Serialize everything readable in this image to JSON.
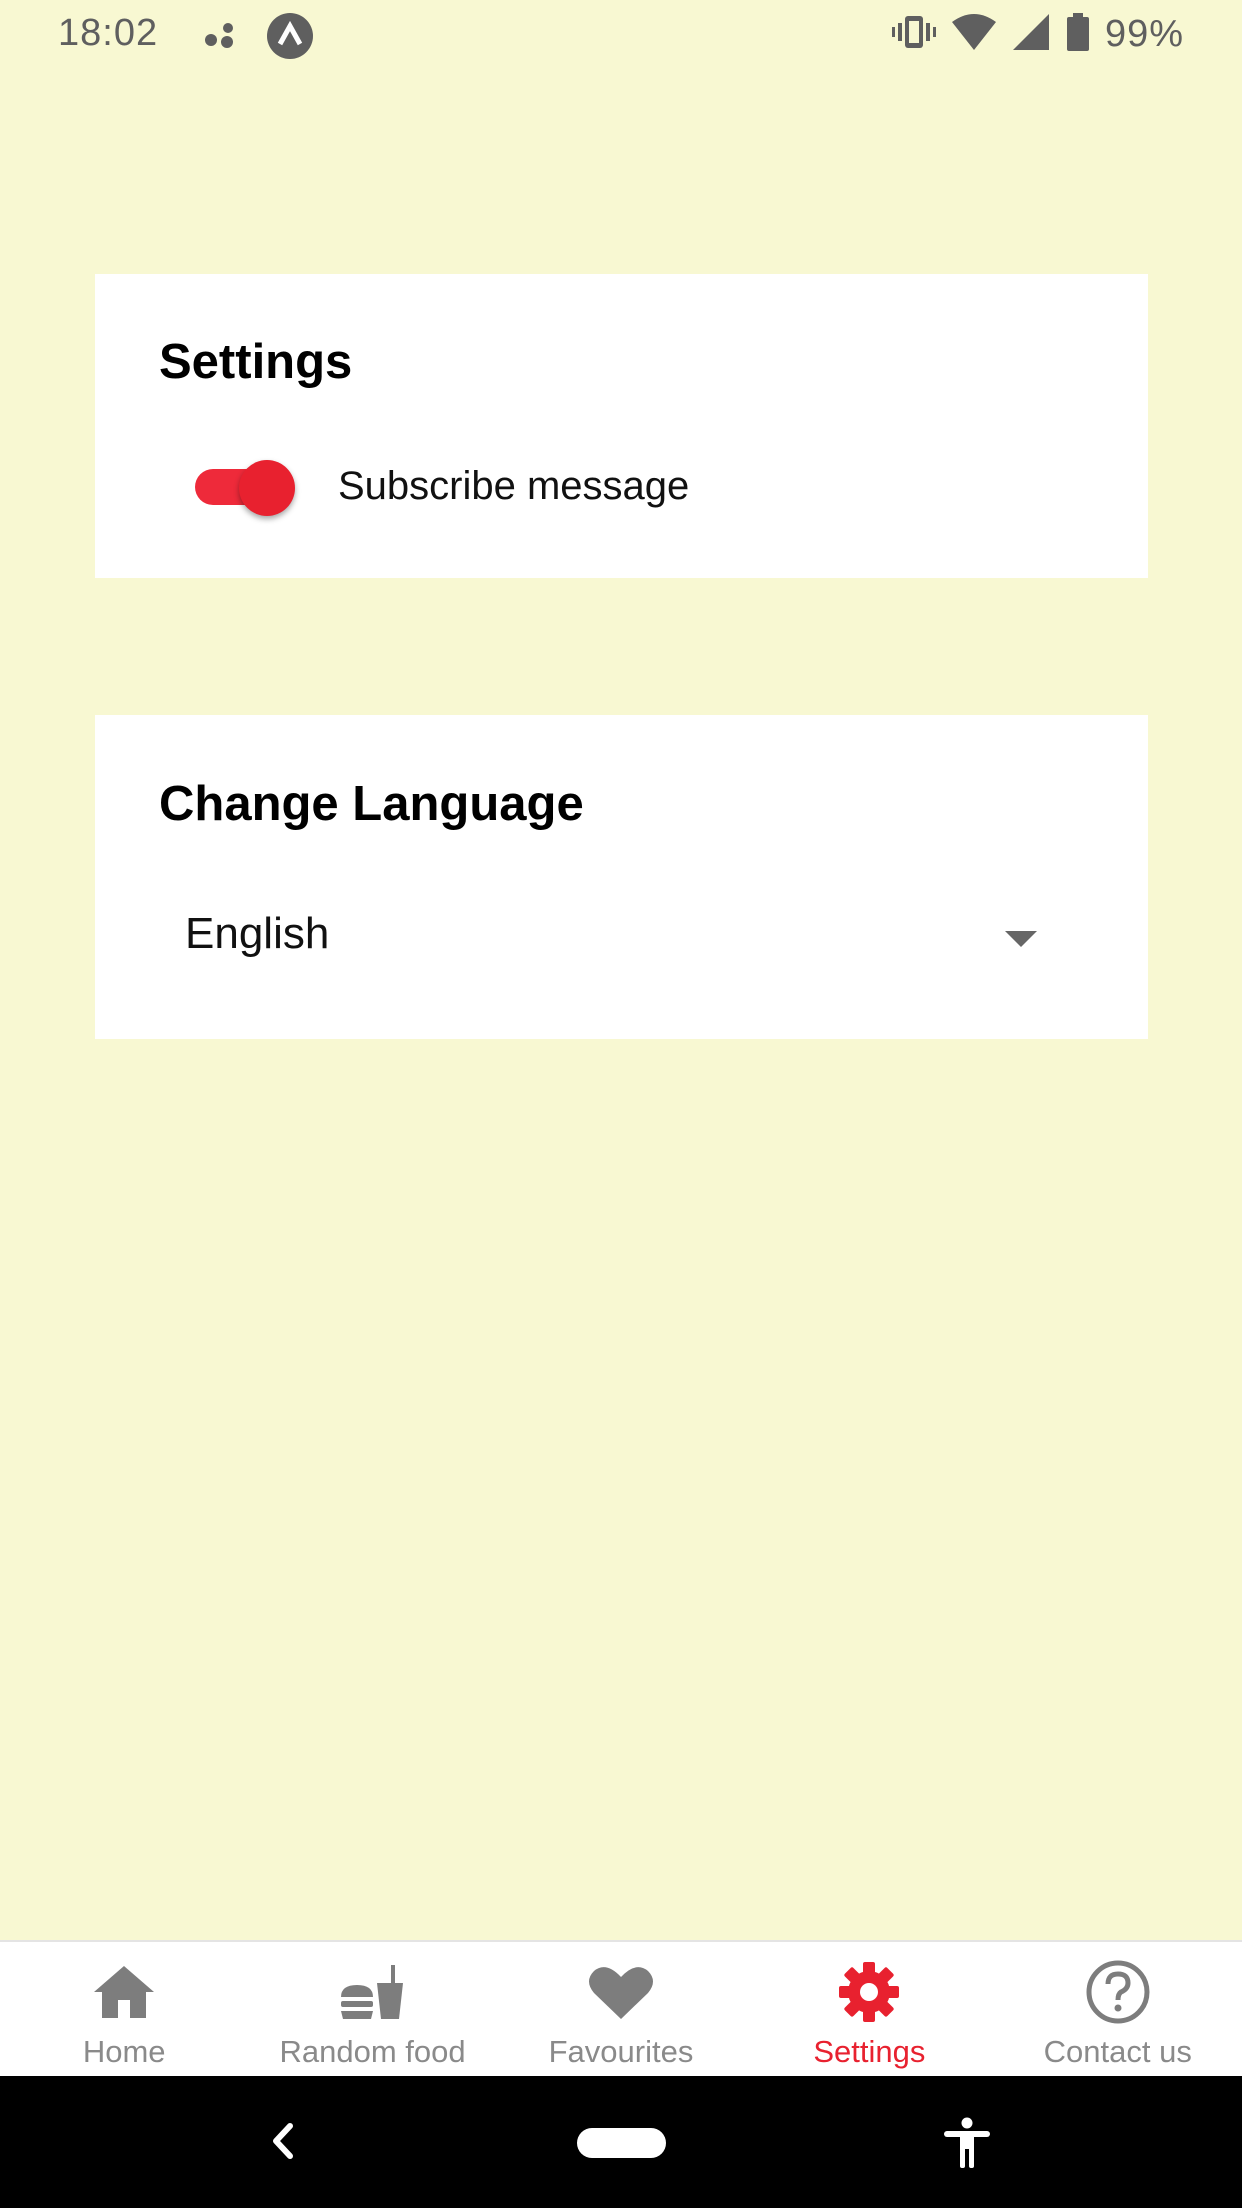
{
  "status_bar": {
    "time": "18:02",
    "battery_percent": "99%",
    "icons": [
      "dots-icon",
      "app-badge-icon",
      "vibrate-icon",
      "wifi-icon",
      "signal-icon",
      "battery-icon"
    ]
  },
  "settings_card": {
    "title": "Settings",
    "subscribe_toggle": {
      "label": "Subscribe message",
      "on": true
    }
  },
  "language_card": {
    "title": "Change Language",
    "selected_language": "English"
  },
  "bottom_nav": {
    "items": [
      {
        "label": "Home",
        "icon": "home-icon",
        "active": false
      },
      {
        "label": "Random food",
        "icon": "fast-food-icon",
        "active": false
      },
      {
        "label": "Favourites",
        "icon": "heart-icon",
        "active": false
      },
      {
        "label": "Settings",
        "icon": "gear-icon",
        "active": true
      },
      {
        "label": "Contact us",
        "icon": "help-circle-icon",
        "active": false
      }
    ]
  },
  "colors": {
    "background": "#f8f8d2",
    "accent": "#e8212f",
    "inactive": "#8a8a8a"
  }
}
